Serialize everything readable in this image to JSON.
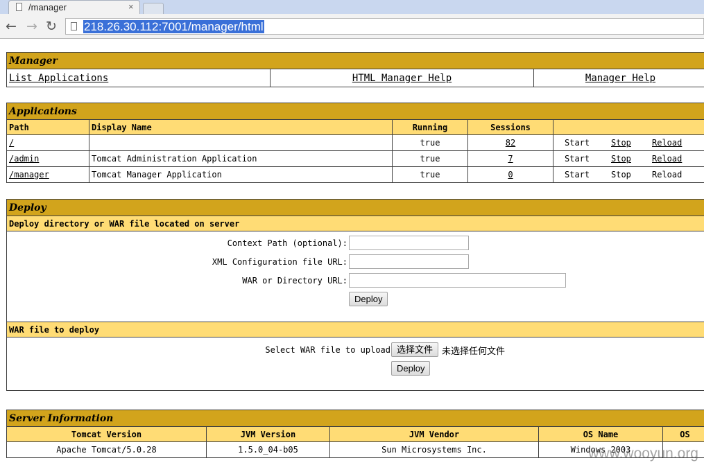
{
  "browser": {
    "tab_title": "/manager",
    "tab_close": "×",
    "back": "←",
    "forward": "→",
    "reload": "↻",
    "url": "218.26.30.112:7001/manager/html"
  },
  "manager": {
    "title": "Manager",
    "links": [
      "List Applications",
      "HTML Manager Help",
      "Manager Help"
    ]
  },
  "applications": {
    "title": "Applications",
    "headers": {
      "path": "Path",
      "display_name": "Display Name",
      "running": "Running",
      "sessions": "Sessions"
    },
    "rows": [
      {
        "path": "/",
        "display_name": "",
        "running": "true",
        "sessions": "82",
        "start": "Start",
        "stop": "Stop",
        "reload": "Reload"
      },
      {
        "path": "/admin",
        "display_name": "Tomcat Administration Application",
        "running": "true",
        "sessions": "7",
        "start": "Start",
        "stop": "Stop",
        "reload": "Reload"
      },
      {
        "path": "/manager",
        "display_name": "Tomcat Manager Application",
        "running": "true",
        "sessions": "0",
        "start": "Start",
        "stop": "Stop",
        "reload": "Reload"
      }
    ]
  },
  "deploy": {
    "title": "Deploy",
    "server_section": "Deploy directory or WAR file located on server",
    "context_path_label": "Context Path (optional):",
    "xml_config_label": "XML Configuration file URL:",
    "war_dir_label": "WAR or Directory URL:",
    "deploy_button": "Deploy",
    "upload_section": "WAR file to deploy",
    "select_label": "Select WAR file to upload",
    "choose_file_button": "选择文件",
    "no_file_text": "未选择任何文件",
    "upload_deploy_button": "Deploy"
  },
  "server_info": {
    "title": "Server Information",
    "headers": {
      "tomcat_version": "Tomcat Version",
      "jvm_version": "JVM Version",
      "jvm_vendor": "JVM Vendor",
      "os_name": "OS Name",
      "os_more": "OS"
    },
    "values": {
      "tomcat_version": "Apache Tomcat/5.0.28",
      "jvm_version": "1.5.0_04-b05",
      "jvm_vendor": "Sun Microsystems Inc.",
      "os_name": "Windows 2003"
    }
  },
  "watermark": "www.wooyun.org"
}
